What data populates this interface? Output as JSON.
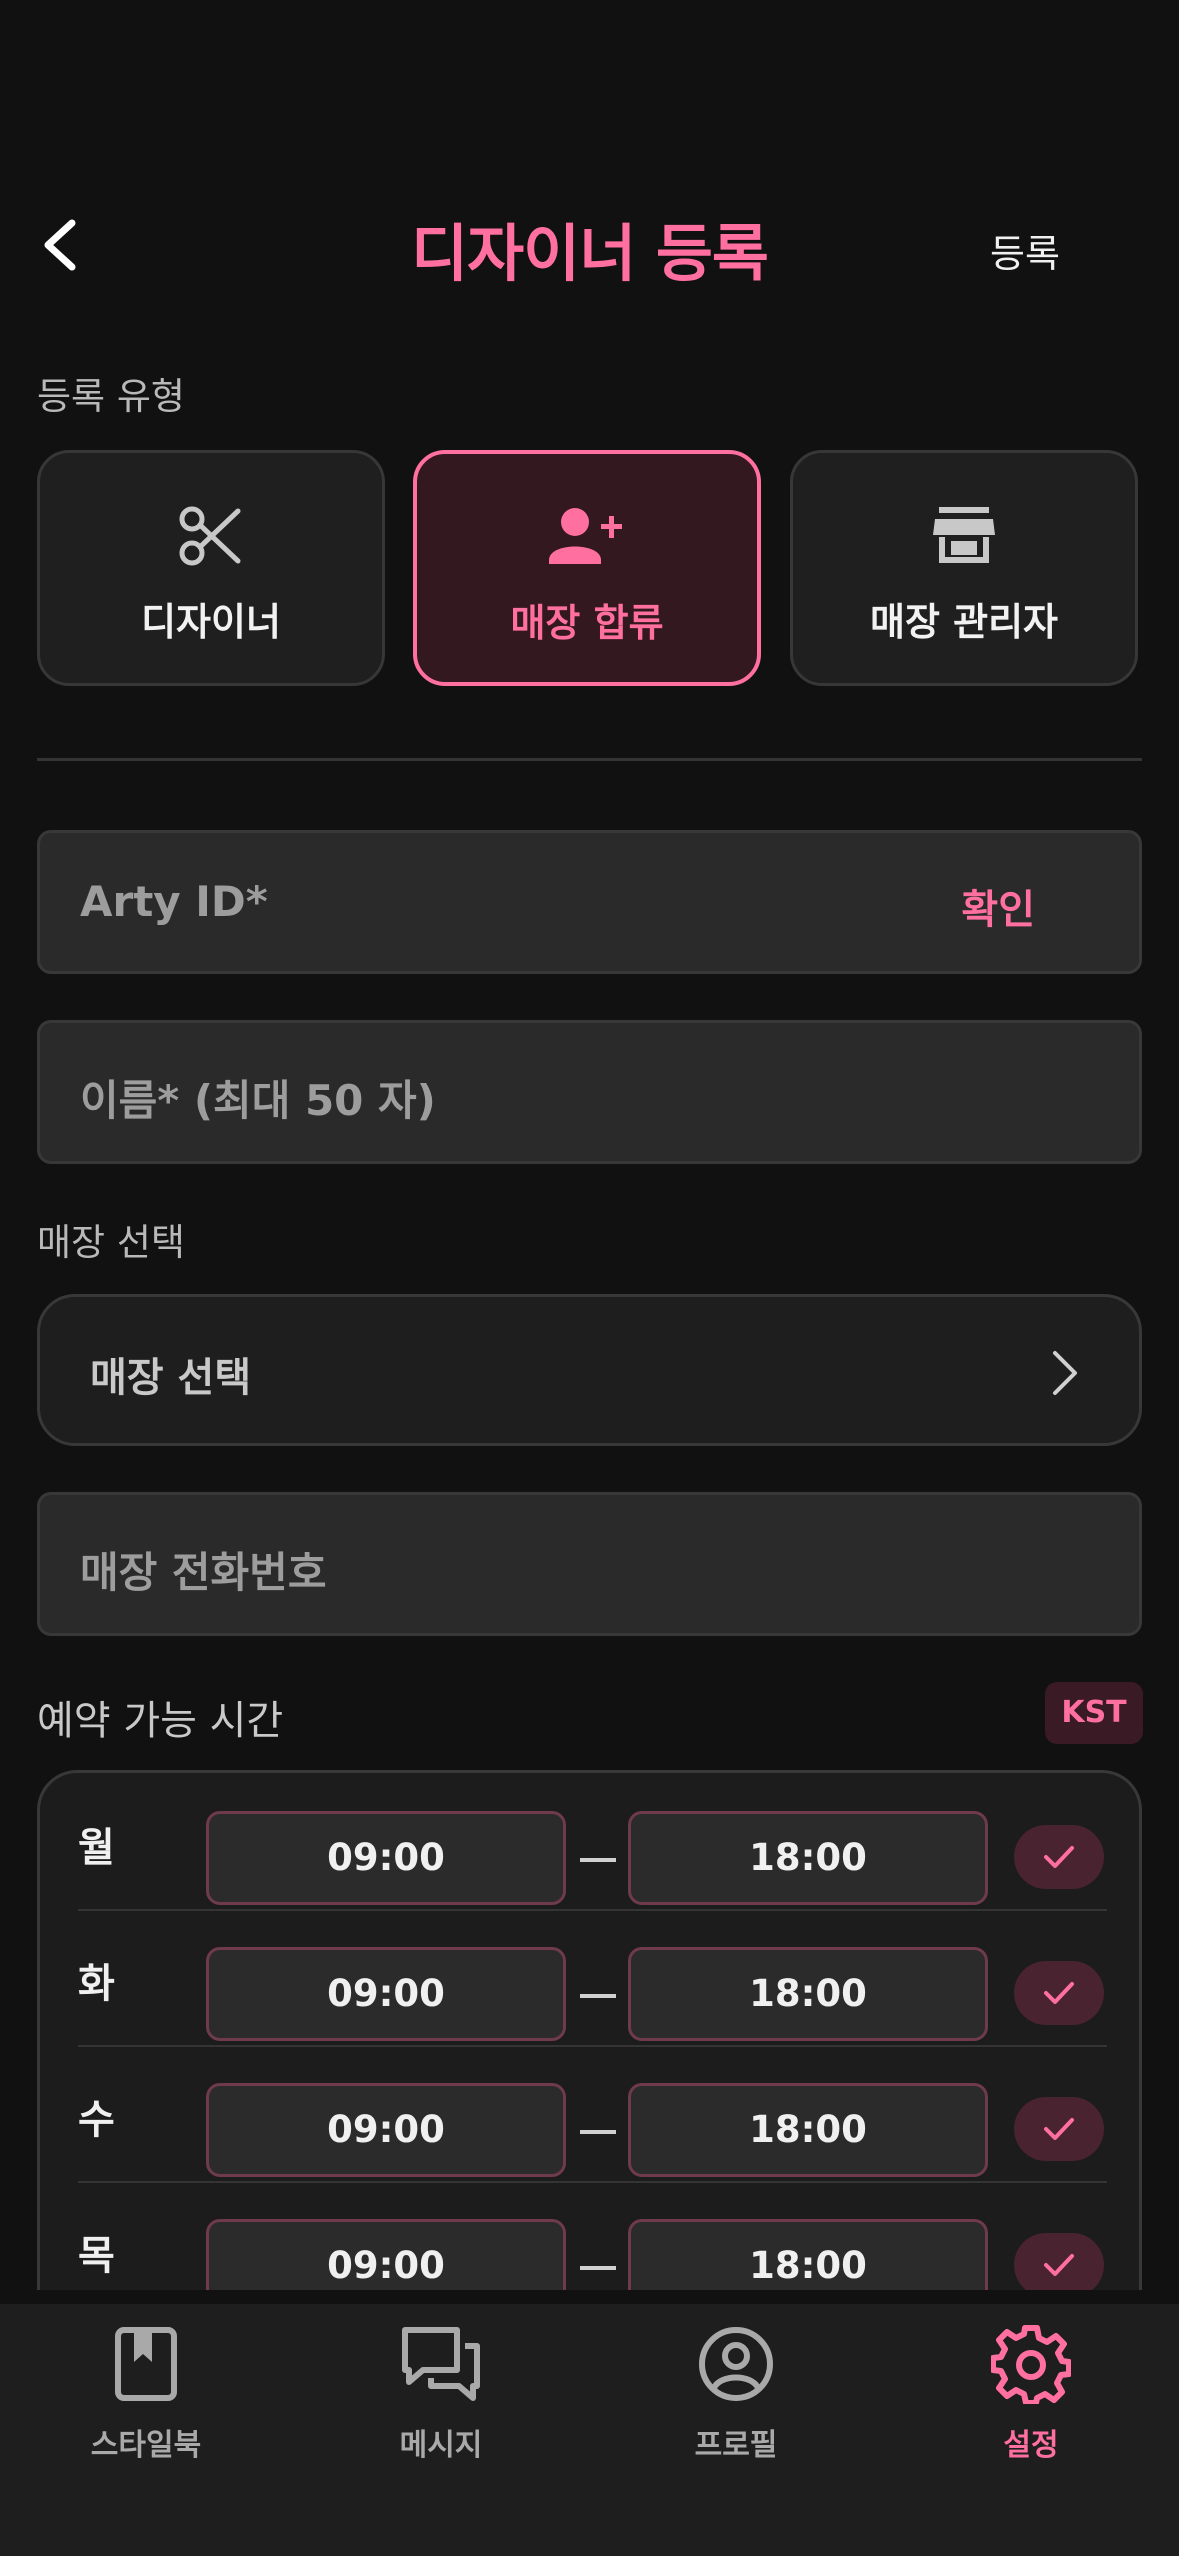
{
  "header": {
    "title": "디자이너 등록",
    "register_label": "등록"
  },
  "registration_type": {
    "label": "등록 유형",
    "options": [
      {
        "label": "디자이너",
        "icon": "scissors-icon",
        "selected": false
      },
      {
        "label": "매장 합류",
        "icon": "person-add-icon",
        "selected": true
      },
      {
        "label": "매장 관리자",
        "icon": "store-icon",
        "selected": false
      }
    ]
  },
  "form": {
    "arty_id_placeholder": "Arty ID*",
    "confirm_label": "확인",
    "name_placeholder": "이름* (최대 50 자)",
    "store_section_label": "매장 선택",
    "store_select_placeholder": "매장 선택",
    "store_phone_placeholder": "매장 전화번호"
  },
  "availability": {
    "label": "예약 가능 시간",
    "timezone": "KST",
    "days": [
      {
        "day": "월",
        "start": "09:00",
        "end": "18:00",
        "enabled": true
      },
      {
        "day": "화",
        "start": "09:00",
        "end": "18:00",
        "enabled": true
      },
      {
        "day": "수",
        "start": "09:00",
        "end": "18:00",
        "enabled": true
      },
      {
        "day": "목",
        "start": "09:00",
        "end": "18:00",
        "enabled": true
      }
    ]
  },
  "bottom_nav": {
    "items": [
      {
        "label": "스타일북",
        "icon": "book-icon",
        "active": false
      },
      {
        "label": "메시지",
        "icon": "chat-icon",
        "active": false
      },
      {
        "label": "프로필",
        "icon": "profile-icon",
        "active": false
      },
      {
        "label": "설정",
        "icon": "gear-icon",
        "active": true
      }
    ]
  },
  "colors": {
    "accent": "#ff6fa0",
    "background": "#111111",
    "surface": "#2a2a2a"
  }
}
